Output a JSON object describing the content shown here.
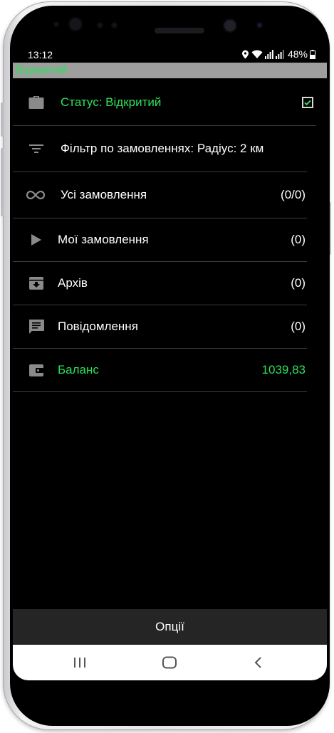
{
  "status_bar": {
    "time": "13:12",
    "battery_percent": "48%",
    "icons": [
      "location-icon",
      "wifi-icon",
      "signal-icon",
      "signal-icon",
      "battery-icon"
    ]
  },
  "app_bar": {
    "title": "Відкритий"
  },
  "menu": {
    "status_label": "Статус: Відкритий",
    "status_checked": true,
    "filter_label": "Фільтр по замовленнях: Радіус: 2 км",
    "all_orders_label": "Усі замовлення",
    "all_orders_count": "(0/0)",
    "my_orders_label": "Мої замовлення",
    "my_orders_count": "(0)",
    "archive_label": "Архів",
    "archive_count": "(0)",
    "messages_label": "Повідомлення",
    "messages_count": "(0)",
    "balance_label": "Баланс",
    "balance_value": "1039,83"
  },
  "bottom_bar": {
    "options_label": "Опції"
  },
  "navigation": {
    "buttons": [
      "recent-apps-icon",
      "home-icon",
      "back-icon"
    ]
  },
  "colors": {
    "accent_green": "#2de05a",
    "app_bar_bg": "#9e9e9e",
    "bottom_bar_bg": "#252525",
    "divider": "#3b3b3b",
    "icon_grey": "#8a8a8a"
  }
}
